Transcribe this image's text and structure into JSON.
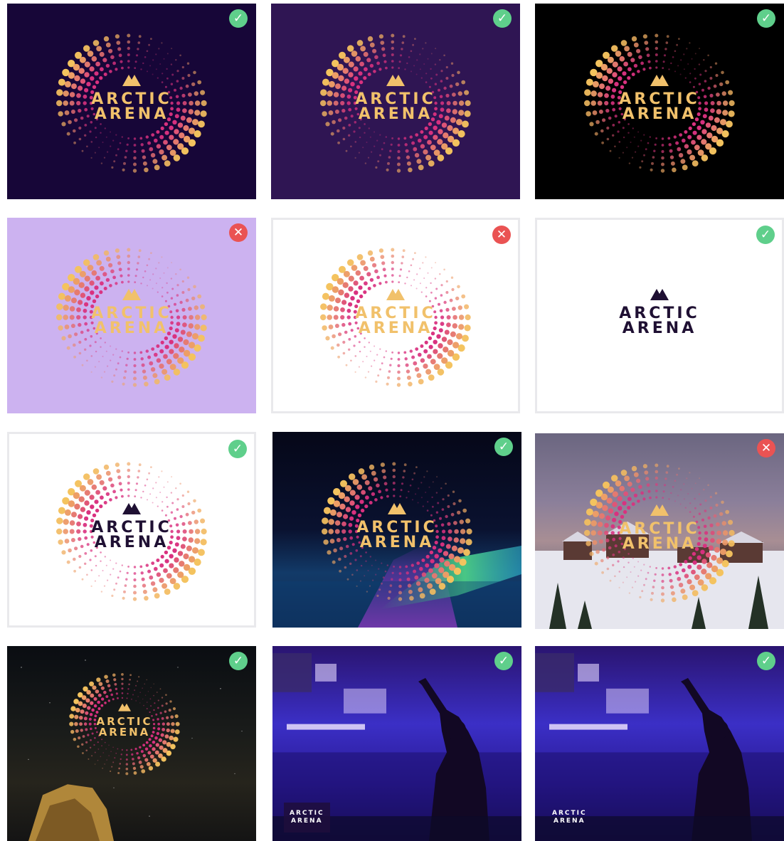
{
  "brand": {
    "line1": "ARCTIC",
    "line2": "ARENA"
  },
  "tiles": [
    {
      "id": "deep-violet",
      "status": "ok",
      "mark": "✓"
    },
    {
      "id": "purple",
      "status": "ok",
      "mark": "✓"
    },
    {
      "id": "black",
      "status": "ok",
      "mark": "✓"
    },
    {
      "id": "lilac",
      "status": "no",
      "mark": "✕"
    },
    {
      "id": "white-gold",
      "status": "no",
      "mark": "✕"
    },
    {
      "id": "white-mono",
      "status": "ok",
      "mark": "✓"
    },
    {
      "id": "white-light",
      "status": "ok",
      "mark": "✓"
    },
    {
      "id": "aurora",
      "status": "ok",
      "mark": "✓"
    },
    {
      "id": "village",
      "status": "no",
      "mark": "✕"
    },
    {
      "id": "space",
      "status": "ok",
      "mark": "✓"
    },
    {
      "id": "arena-box",
      "status": "ok",
      "mark": "✓"
    },
    {
      "id": "arena-plain",
      "status": "ok",
      "mark": "✓"
    }
  ],
  "colors": {
    "gold": "#f1c16b",
    "pink": "#e0407f",
    "ok": "#5fcf8b",
    "no": "#ea5353",
    "navy": "#1f1033"
  },
  "icons": {
    "ok": "check-icon",
    "no": "cross-icon",
    "logo": "mountain-icon"
  }
}
